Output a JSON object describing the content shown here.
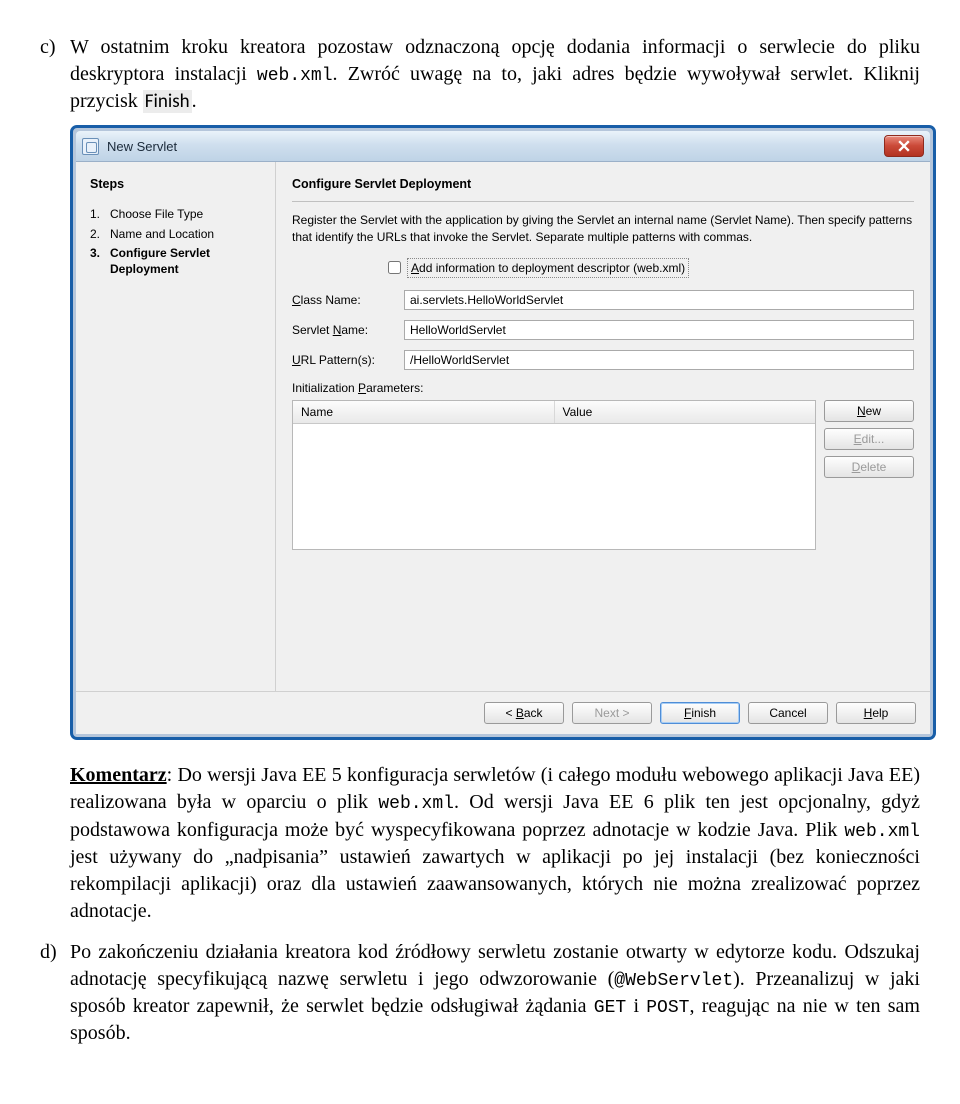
{
  "doc": {
    "item_c": {
      "marker": "c)",
      "p1_a": "W ostatnim kroku kreatora pozostaw odznaczoną opcję dodania informacji o serwlecie do pliku deskryptora instalacji ",
      "p1_code": "web.xml",
      "p1_b": ". Zwróć uwagę na to, jaki adres będzie wywoływał serwlet. Kliknij przycisk ",
      "p1_btn": "Finish",
      "p1_c": "."
    },
    "komentarz": {
      "label": "Komentarz",
      "t1": ": Do wersji Java EE 5 konfiguracja serwletów (i całego modułu webowego aplikacji Java EE) realizowana była w oparciu o plik ",
      "c1": "web.xml",
      "t2": ". Od wersji Java EE 6 plik ten jest opcjonalny, gdyż podstawowa konfiguracja może być wyspecyfikowana poprzez adnotacje w kodzie Java. Plik ",
      "c2": "web.xml",
      "t3": " jest używany do „nadpisania” ustawień zawartych w aplikacji po jej instalacji (bez konieczności rekompilacji aplikacji) oraz dla ustawień zaawansowanych, których nie można zrealizować poprzez adnotacje."
    },
    "item_d": {
      "marker": "d)",
      "t1": "Po zakończeniu działania kreatora kod źródłowy serwletu zostanie otwarty w edytorze kodu. Odszukaj adnotację specyfikującą nazwę serwletu i jego odwzorowanie (",
      "c1": "@WebServlet",
      "t2": "). Przeanalizuj w jaki sposób kreator zapewnił, że serwlet będzie odsługiwał żądania ",
      "c2": "GET",
      "t3": " i ",
      "c3": "POST",
      "t4": ", reagując na nie w ten sam sposób."
    }
  },
  "dialog": {
    "title": "New Servlet",
    "steps_header": "Steps",
    "steps": [
      {
        "num": "1.",
        "label": "Choose File Type"
      },
      {
        "num": "2.",
        "label": "Name and Location"
      },
      {
        "num": "3.",
        "label": "Configure Servlet Deployment"
      }
    ],
    "heading": "Configure Servlet Deployment",
    "description": "Register the Servlet with the application by giving the Servlet an internal name (Servlet Name). Then specify patterns that identify the URLs that invoke the Servlet. Separate multiple patterns with commas.",
    "checkbox_prefix": "A",
    "checkbox_rest": "dd information to deployment descriptor (web.xml)",
    "fields": {
      "class_lbl_pre": "C",
      "class_lbl_rest": "lass Name:",
      "class_val": "ai.servlets.HelloWorldServlet",
      "servlet_lbl_pre": "Servlet ",
      "servlet_lbl_u": "N",
      "servlet_lbl_rest": "ame:",
      "servlet_val": "HelloWorldServlet",
      "url_lbl_pre": "U",
      "url_lbl_rest": "RL Pattern(s):",
      "url_val": "/HelloWorldServlet"
    },
    "init_label_pre": "Initialization ",
    "init_label_u": "P",
    "init_label_rest": "arameters:",
    "table": {
      "col1": "Name",
      "col2": "Value"
    },
    "side": {
      "new_u": "N",
      "new_rest": "ew",
      "edit_u": "E",
      "edit_rest": "dit...",
      "del_u": "D",
      "del_rest": "elete"
    },
    "footer": {
      "back": "< Back",
      "back_u": "B",
      "next": "Next >",
      "finish": "Finish",
      "finish_u": "F",
      "cancel": "Cancel",
      "help": "Help",
      "help_u": "H"
    }
  }
}
